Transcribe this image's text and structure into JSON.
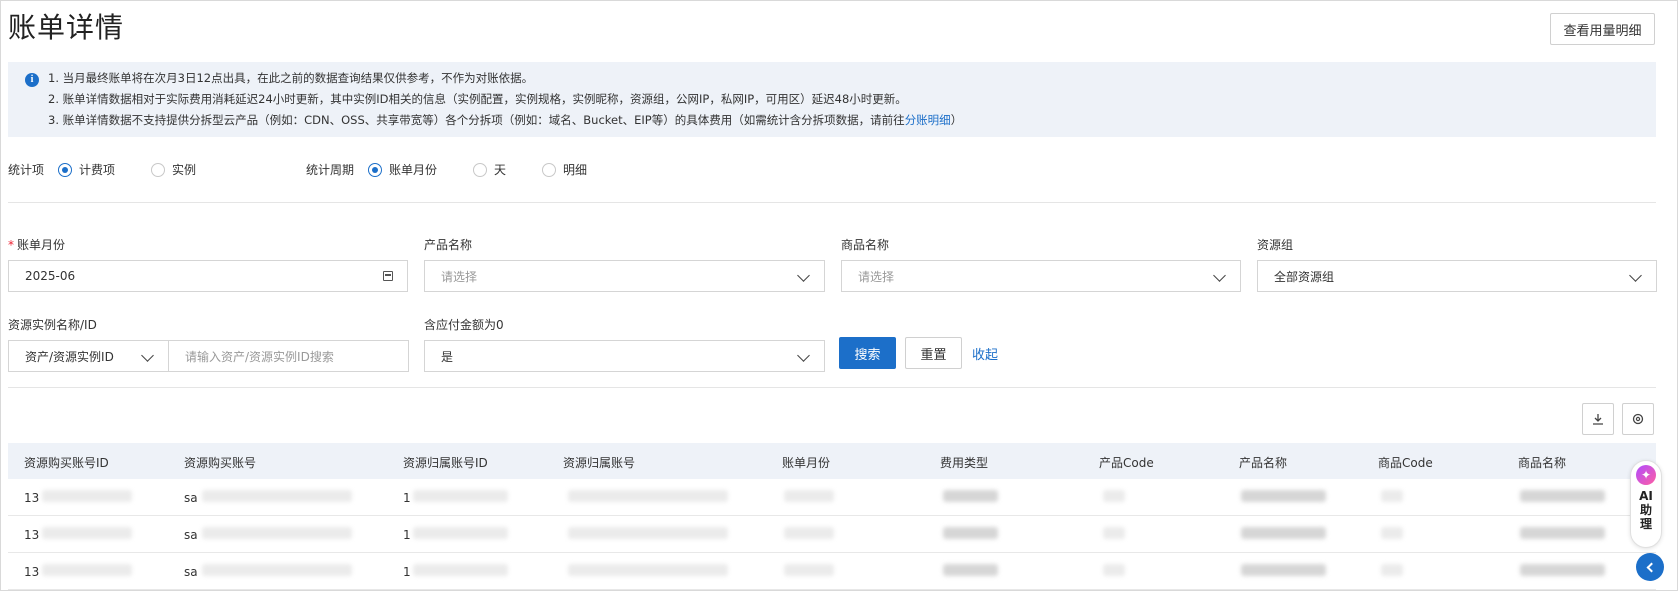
{
  "header": {
    "title": "账单详情",
    "usage_button": "查看用量明细"
  },
  "notice": {
    "line1": "1. 当月最终账单将在次月3日12点出具，在此之前的数据查询结果仅供参考，不作为对账依据。",
    "line2": "2. 账单详情数据相对于实际费用消耗延迟24小时更新，其中实例ID相关的信息（实例配置，实例规格，实例昵称，资源组，公网IP，私网IP，可用区）延迟48小时更新。",
    "line3_prefix": "3. 账单详情数据不支持提供分拆型云产品（例如：CDN、OSS、共享带宽等）各个分拆项（例如：域名、Bucket、EIP等）的具体费用（如需统计含分拆项数据，请前往",
    "line3_link": "分账明细",
    "line3_suffix": "）"
  },
  "stat_item": {
    "label": "统计项",
    "options": [
      "计费项",
      "实例"
    ],
    "selected": "计费项"
  },
  "stat_period": {
    "label": "统计周期",
    "options": [
      "账单月份",
      "天",
      "明细"
    ],
    "selected": "账单月份"
  },
  "filters": {
    "bill_month": {
      "label": "账单月份",
      "value": "2025-06",
      "required": true
    },
    "product_name": {
      "label": "产品名称",
      "placeholder": "请选择"
    },
    "commodity_name": {
      "label": "商品名称",
      "placeholder": "请选择"
    },
    "resource_group": {
      "label": "资源组",
      "value": "全部资源组"
    },
    "instance": {
      "label": "资源实例名称/ID",
      "type_value": "资产/资源实例ID",
      "placeholder": "请输入资产/资源实例ID搜索"
    },
    "zero_amount": {
      "label": "含应付金额为0",
      "value": "是"
    }
  },
  "actions": {
    "search": "搜索",
    "reset": "重置",
    "collapse": "收起"
  },
  "toolbar": {
    "download_icon": "download-icon",
    "settings_icon": "gear-icon"
  },
  "table": {
    "columns": [
      "资源购买账号ID",
      "资源购买账号",
      "资源归属账号ID",
      "资源归属账号",
      "账单月份",
      "费用类型",
      "产品Code",
      "产品名称",
      "商品Code",
      "商品名称"
    ],
    "rows": [
      {
        "buyer_id_prefix": "13",
        "buyer_account_prefix": "sa",
        "owner_id_prefix": "1"
      },
      {
        "buyer_id_prefix": "13",
        "buyer_account_prefix": "sa",
        "owner_id_prefix": "1"
      },
      {
        "buyer_id_prefix": "13",
        "buyer_account_prefix": "sa",
        "owner_id_prefix": "1"
      }
    ]
  },
  "ai_helper": {
    "label": "AI助理"
  },
  "colors": {
    "primary": "#1c6fc9",
    "notice_bg": "#eef2f8",
    "header_bg": "#eef2f8"
  }
}
